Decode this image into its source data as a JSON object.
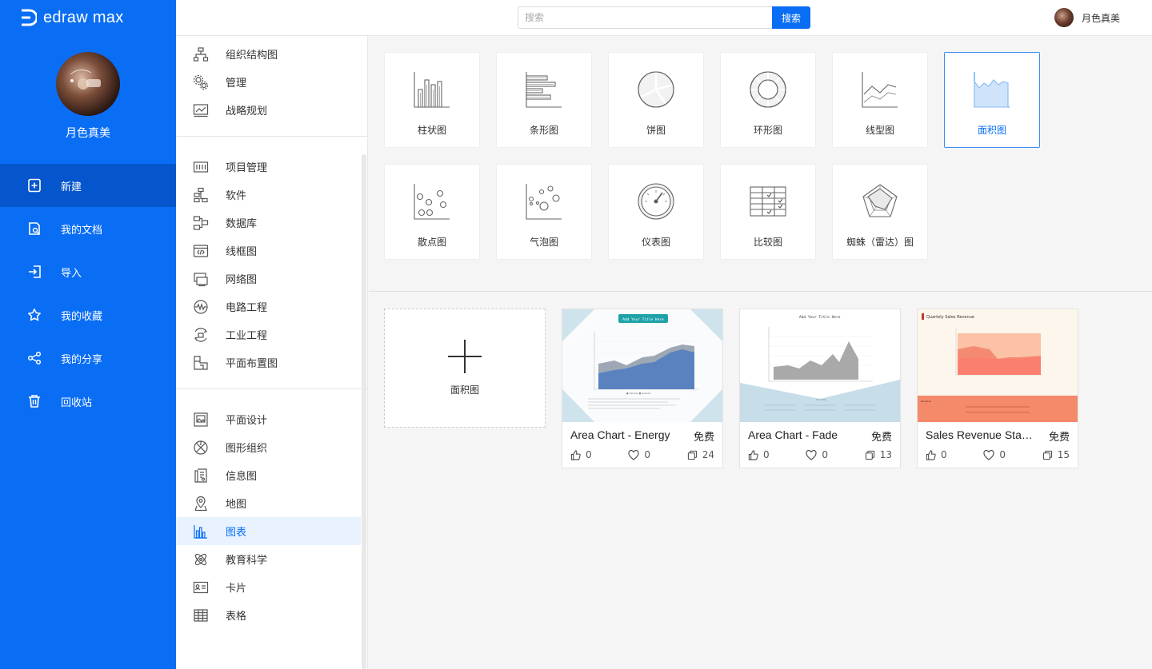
{
  "brand": {
    "name": "edraw max"
  },
  "profile": {
    "name": "月色真美"
  },
  "nav": [
    {
      "label": "新建",
      "icon": "plus-square-icon",
      "active": true
    },
    {
      "label": "我的文档",
      "icon": "document-icon"
    },
    {
      "label": "导入",
      "icon": "import-icon"
    },
    {
      "label": "我的收藏",
      "icon": "star-icon"
    },
    {
      "label": "我的分享",
      "icon": "share-icon"
    },
    {
      "label": "回收站",
      "icon": "trash-icon"
    }
  ],
  "search": {
    "placeholder": "搜索",
    "button": "搜索"
  },
  "user": {
    "name": "月色真美"
  },
  "categories": {
    "group1": [
      "组织结构图",
      "管理",
      "战略规划"
    ],
    "group2": [
      "项目管理",
      "软件",
      "数据库",
      "线框图",
      "网络图",
      "电路工程",
      "工业工程",
      "平面布置图"
    ],
    "group3": [
      "平面设计",
      "图形组织",
      "信息图",
      "地图",
      "图表",
      "教育科学",
      "卡片",
      "表格"
    ],
    "active": "图表"
  },
  "chart_types": [
    {
      "label": "柱状图",
      "icon": "column-chart-icon"
    },
    {
      "label": "条形图",
      "icon": "bar-chart-icon"
    },
    {
      "label": "饼图",
      "icon": "pie-chart-icon"
    },
    {
      "label": "环形图",
      "icon": "donut-chart-icon"
    },
    {
      "label": "线型图",
      "icon": "line-chart-icon"
    },
    {
      "label": "面积图",
      "icon": "area-chart-icon",
      "active": true
    },
    {
      "label": "散点图",
      "icon": "scatter-chart-icon"
    },
    {
      "label": "气泡图",
      "icon": "bubble-chart-icon"
    },
    {
      "label": "仪表图",
      "icon": "gauge-chart-icon"
    },
    {
      "label": "比较图",
      "icon": "comparison-chart-icon"
    },
    {
      "label": "蜘蛛（雷达）图",
      "icon": "radar-chart-icon"
    }
  ],
  "new_template": {
    "label": "面积图"
  },
  "templates": [
    {
      "title": "Area Chart - Energy",
      "price": "免费",
      "likes": "0",
      "favorites": "0",
      "copies": "24",
      "thumb_title": "Add Your Title Here"
    },
    {
      "title": "Area Chart - Fade",
      "price": "免费",
      "likes": "0",
      "favorites": "0",
      "copies": "13",
      "thumb_title": "Add Your Title Here"
    },
    {
      "title": "Sales Revenue Stacked Area Chart",
      "price": "免费",
      "likes": "0",
      "favorites": "0",
      "copies": "15",
      "thumb_title": "Quartely Sales Revenue"
    }
  ],
  "colors": {
    "primary": "#0a6ef5",
    "primary_dark": "#0556cc",
    "active_bg": "#e8f3ff"
  }
}
